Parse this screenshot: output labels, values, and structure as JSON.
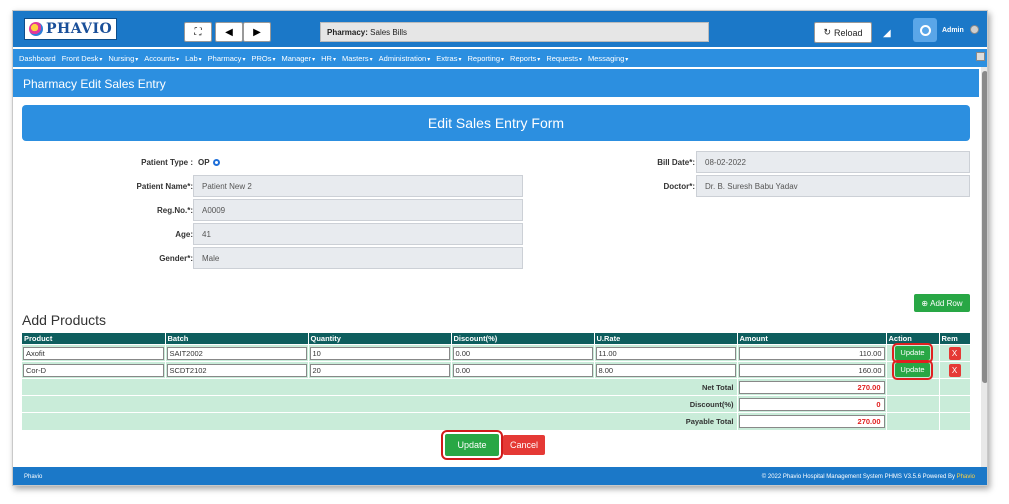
{
  "header": {
    "logo_text": "PHAVIO",
    "pharmacy_label": "Pharmacy:",
    "pharmacy_value": "Sales Bills",
    "reload_label": "Reload",
    "user_name": "Admin"
  },
  "nav": {
    "items": [
      {
        "label": "Dashboard",
        "caret": ""
      },
      {
        "label": "Front Desk",
        "caret": "▾"
      },
      {
        "label": "Nursing",
        "caret": "▾"
      },
      {
        "label": "Accounts",
        "caret": "▾"
      },
      {
        "label": "Lab",
        "caret": "▾"
      },
      {
        "label": "Pharmacy",
        "caret": "▾"
      },
      {
        "label": "PROs",
        "caret": "▾"
      },
      {
        "label": "Manager",
        "caret": "▾"
      },
      {
        "label": "HR",
        "caret": "▾"
      },
      {
        "label": "Masters",
        "caret": "▾"
      },
      {
        "label": "Administration",
        "caret": "▾"
      },
      {
        "label": "Extras",
        "caret": "▾"
      },
      {
        "label": "Reporting",
        "caret": "▾"
      },
      {
        "label": "Reports",
        "caret": "▾"
      },
      {
        "label": "Requests",
        "caret": "▾"
      },
      {
        "label": "Messaging",
        "caret": "▾"
      }
    ]
  },
  "page": {
    "subtitle": "Pharmacy Edit Sales Entry",
    "form_title": "Edit Sales Entry Form"
  },
  "form": {
    "patient_type_label": "Patient Type :",
    "patient_type_value": "OP",
    "patient_name_label": "Patient Name*:",
    "patient_name_value": "Patient New 2",
    "reg_no_label": "Reg.No.*:",
    "reg_no_value": "A0009",
    "age_label": "Age:",
    "age_value": "41",
    "gender_label": "Gender*:",
    "gender_value": "Male",
    "bill_date_label": "Bill Date*:",
    "bill_date_value": "08-02-2022",
    "doctor_label": "Doctor*:",
    "doctor_value": "Dr. B. Suresh Babu Yadav"
  },
  "products": {
    "section_title": "Add Products",
    "add_row_label": "Add Row",
    "columns": [
      "Product",
      "Batch",
      "Quantity",
      "Discount(%)",
      "U.Rate",
      "Amount",
      "Action",
      "Rem"
    ],
    "rows": [
      {
        "product": "Axofit",
        "batch": "SAIT2002",
        "quantity": "10",
        "discount": "0.00",
        "rate": "11.00",
        "amount": "110.00",
        "action": "Update",
        "rem": "X"
      },
      {
        "product": "Cor-D",
        "batch": "SCDT2102",
        "quantity": "20",
        "discount": "0.00",
        "rate": "8.00",
        "amount": "160.00",
        "action": "Update",
        "rem": "X"
      }
    ],
    "net_total_label": "Net Total",
    "net_total_value": "270.00",
    "discount_label": "Discount(%)",
    "discount_value": "0",
    "payable_total_label": "Payable Total",
    "payable_total_value": "270.00"
  },
  "actions": {
    "update_label": "Update",
    "cancel_label": "Cancel"
  },
  "footer": {
    "left": "Phavio",
    "right_prefix": "© 2022 Phavio Hospital Management System PHMS V3.5.6 Powered By",
    "right_brand": "Phavio"
  },
  "colors": {
    "primary": "#2c8fe0",
    "header": "#1b78c8",
    "table_header": "#0e5e5e",
    "table_body": "#c9ecd9",
    "success": "#28a745",
    "danger": "#e53935"
  }
}
